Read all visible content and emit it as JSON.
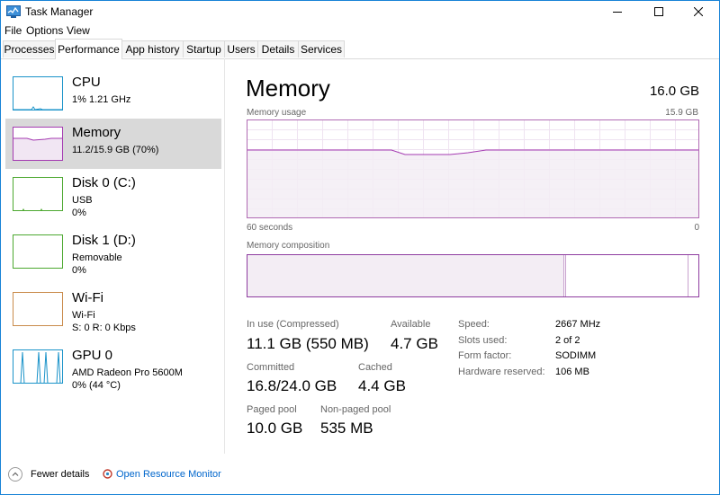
{
  "window": {
    "title": "Task Manager"
  },
  "menu": [
    "File",
    "Options",
    "View"
  ],
  "tabs": [
    "Processes",
    "Performance",
    "App history",
    "Startup",
    "Users",
    "Details",
    "Services"
  ],
  "active_tab": "Performance",
  "sidebar": {
    "items": [
      {
        "name": "CPU",
        "sub1": "1% 1.21 GHz",
        "sub2": "",
        "color": "#1a93c9"
      },
      {
        "name": "Memory",
        "sub1": "11.2/15.9 GB (70%)",
        "sub2": "",
        "color": "#a43ab1"
      },
      {
        "name": "Disk 0 (C:)",
        "sub1": "USB",
        "sub2": "0%",
        "color": "#4ca82f"
      },
      {
        "name": "Disk 1 (D:)",
        "sub1": "Removable",
        "sub2": "0%",
        "color": "#4ca82f"
      },
      {
        "name": "Wi-Fi",
        "sub1": "Wi-Fi",
        "sub2": "S: 0 R: 0 Kbps",
        "color": "#b5651d"
      },
      {
        "name": "GPU 0",
        "sub1": "AMD Radeon Pro 5600M",
        "sub2": "0% (44 °C)",
        "color": "#1a93c9"
      }
    ]
  },
  "main": {
    "title": "Memory",
    "total": "16.0 GB",
    "usage_label": "Memory usage",
    "usage_max": "15.9 GB",
    "axis_left": "60 seconds",
    "axis_right": "0",
    "composition_label": "Memory composition",
    "in_use_fraction": 0.7
  },
  "stats": {
    "in_use_label": "In use (Compressed)",
    "in_use_value": "11.1 GB (550 MB)",
    "available_label": "Available",
    "available_value": "4.7 GB",
    "committed_label": "Committed",
    "committed_value": "16.8/24.0 GB",
    "cached_label": "Cached",
    "cached_value": "4.4 GB",
    "paged_label": "Paged pool",
    "paged_value": "10.0 GB",
    "nonpaged_label": "Non-paged pool",
    "nonpaged_value": "535 MB"
  },
  "details": {
    "speed_label": "Speed:",
    "speed_value": "2667 MHz",
    "slots_label": "Slots used:",
    "slots_value": "2 of 2",
    "form_label": "Form factor:",
    "form_value": "SODIMM",
    "hw_label": "Hardware reserved:",
    "hw_value": "106 MB"
  },
  "footer": {
    "fewer": "Fewer details",
    "resmon": "Open Resource Monitor"
  },
  "colors": {
    "memory": "#a43ab1",
    "memory_fill": "#f4f2f4",
    "accent": "#1883d7"
  }
}
